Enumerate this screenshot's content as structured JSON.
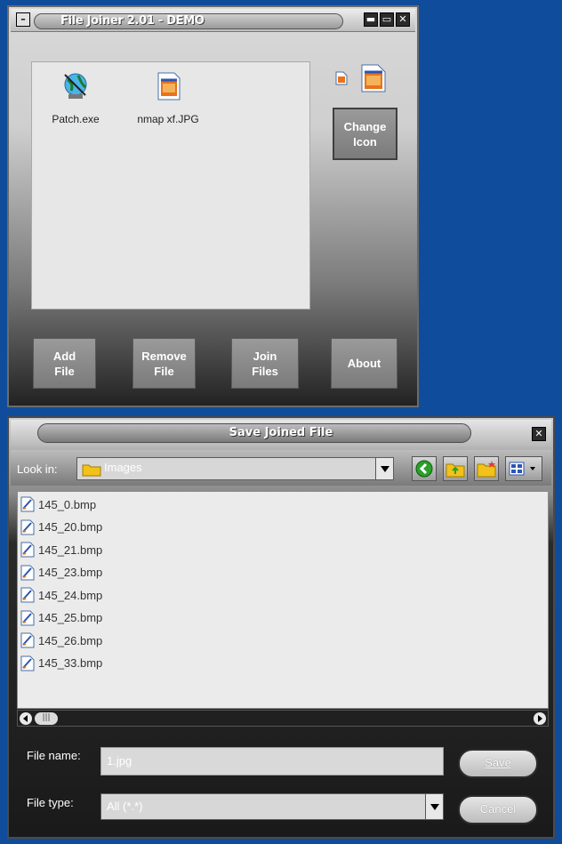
{
  "joiner": {
    "title": "File Joiner 2.01 - DEMO",
    "files": [
      {
        "name": "Patch.exe",
        "icon": "globe-exe-icon"
      },
      {
        "name": "nmap xf.JPG",
        "icon": "jpg-file-icon"
      }
    ],
    "change_icon_label": "Change\nIcon",
    "buttons": {
      "add": "Add\nFile",
      "remove": "Remove\nFile",
      "join": "Join\nFiles",
      "about": "About"
    }
  },
  "save_dialog": {
    "title": "Save Joined File",
    "look_in_label": "Look in:",
    "look_in_value": "Images",
    "files": [
      "145_0.bmp",
      "145_20.bmp",
      "145_21.bmp",
      "145_23.bmp",
      "145_24.bmp",
      "145_25.bmp",
      "145_26.bmp",
      "145_33.bmp"
    ],
    "file_name_label": "File name:",
    "file_name_value": "1.jpg",
    "file_type_label": "File type:",
    "file_type_value": "All (*.*)",
    "save_label": "Save",
    "cancel_label": "Cancel",
    "scroll_thumb": "|||"
  },
  "colors": {
    "desktop": "#0f4d9c",
    "back_green": "#2aa02a",
    "folder_yellow": "#f2c21a"
  }
}
